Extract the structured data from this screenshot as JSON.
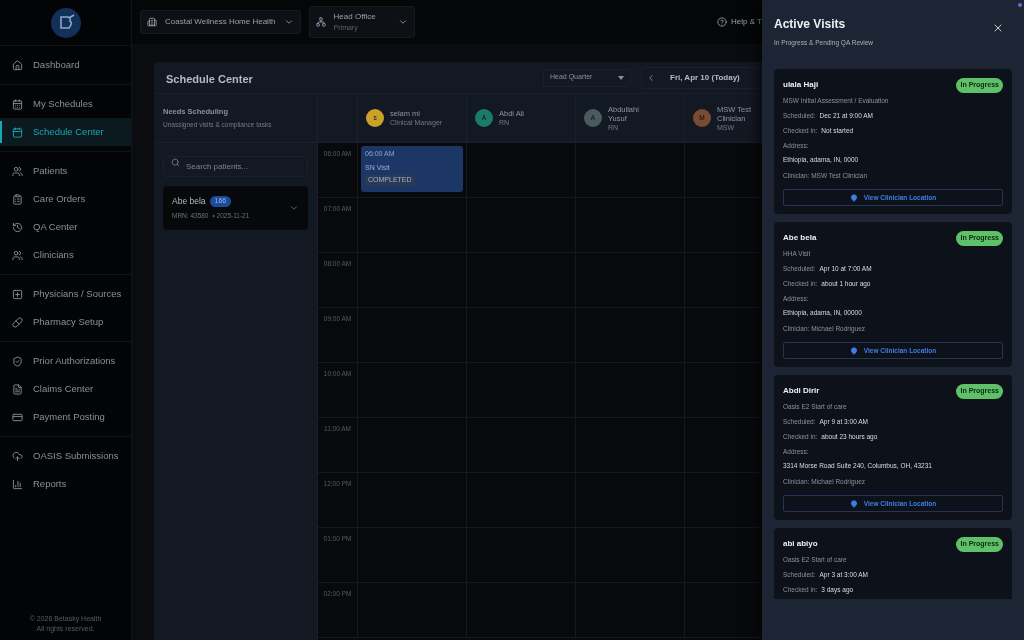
{
  "sidebar": {
    "groups": [
      [
        {
          "label": "Dashboard",
          "selected": false
        }
      ],
      [
        {
          "label": "My Schedules",
          "selected": false
        },
        {
          "label": "Schedule Center",
          "selected": true
        }
      ],
      [
        {
          "label": "Patients",
          "selected": false
        },
        {
          "label": "Care Orders",
          "selected": false
        },
        {
          "label": "QA Center",
          "selected": false
        },
        {
          "label": "Clinicians",
          "selected": false
        }
      ],
      [
        {
          "label": "Physicians / Sources",
          "selected": false
        },
        {
          "label": "Pharmacy Setup",
          "selected": false
        }
      ],
      [
        {
          "label": "Prior Authorizations",
          "selected": false
        },
        {
          "label": "Claims Center",
          "selected": false
        },
        {
          "label": "Payment Posting",
          "selected": false
        }
      ],
      [
        {
          "label": "OASIS Submissions",
          "selected": false
        },
        {
          "label": "Reports",
          "selected": false
        }
      ]
    ],
    "footer": [
      "© 2026 Betasky Health",
      "All rights reserved."
    ]
  },
  "top_bar": {
    "organization": "Coastal Wellness Home Health",
    "office": {
      "name": "Head Office",
      "subtitle": "Primary"
    },
    "help": "Help & T"
  },
  "schedule": {
    "title": "Schedule Center",
    "location_filter": "Head Quarter",
    "date": "Fri, Apr 10 (Today)",
    "needs_scheduling": {
      "title": "Needs Scheduling",
      "subtitle": "Unassigned visits & compliance tasks",
      "search_placeholder": "Search patients...",
      "patients": [
        {
          "name": "Abe bela",
          "count": "166",
          "mrn": "MRN: 43580",
          "date": "• 2025-11-21",
          "expanded": false
        }
      ]
    },
    "clinicians": [
      {
        "initial": "s",
        "name": "selam mi",
        "role": "Clinical Manager",
        "color": "#c9a227",
        "events": [
          {
            "time": "06:00 AM",
            "title": "SN Visit",
            "status": "COMPLETED"
          }
        ]
      },
      {
        "initial": "A",
        "name": "Abdi Ali",
        "role": "RN",
        "color": "#1b7a68"
      },
      {
        "initial": "A",
        "name": "Abdullahi Yusuf",
        "role": "RN",
        "color": "#4a5a5e"
      },
      {
        "initial": "M",
        "name": "MSW Test Clinician",
        "role": "MSW",
        "color": "#7a4a33"
      }
    ],
    "times": [
      "06:00 AM",
      "07:00 AM",
      "08:00 AM",
      "09:00 AM",
      "10:00 AM",
      "11:00 AM",
      "12:00 PM",
      "01:00 PM",
      "02:00 PM"
    ]
  },
  "drawer": {
    "title": "Active Visits",
    "subtitle": "In Progress & Pending QA Review",
    "visits": [
      {
        "name": "ulala Haji",
        "status": "In Progress",
        "type": "MSW Initial Assessment / Evaluation",
        "scheduled_label": "Scheduled:",
        "scheduled": "Dec 21 at 9:00 AM",
        "checked_in_label": "Checked in:",
        "checked_in": "Not started",
        "address_label": "Address:",
        "address": "Ethiopia, adama, IN, 0000",
        "clinician": "Clinician: MSW Test Clinician",
        "action": "View Clinician Location"
      },
      {
        "name": "Abe bela",
        "status": "In Progress",
        "type": "HHA Visit",
        "scheduled_label": "Scheduled:",
        "scheduled": "Apr 10 at 7:00 AM",
        "checked_in_label": "Checked in:",
        "checked_in": "about 1 hour ago",
        "address_label": "Address:",
        "address": "Ethiopia, adama, IN, 00000",
        "clinician": "Clinician: Michael Rodriguez",
        "action": "View Clinician Location"
      },
      {
        "name": "Abdi Dirir",
        "status": "In Progress",
        "type": "Oasis E2 Start of care",
        "scheduled_label": "Scheduled:",
        "scheduled": "Apr 9 at 3:00 AM",
        "checked_in_label": "Checked in:",
        "checked_in": "about 23 hours ago",
        "address_label": "Address:",
        "address": "3314 Morse Road Suite 240, Columbus, OH, 43231",
        "clinician": "Clinician: Michael Rodriguez",
        "action": "View Clinician Location"
      },
      {
        "name": "abi abiyo",
        "status": "In Progress",
        "type": "Oasis E2 Start of care",
        "scheduled_label": "Scheduled:",
        "scheduled": "Apr 3 at 3:00 AM",
        "checked_in_label": "Checked in:",
        "checked_in": "3 days ago"
      }
    ]
  }
}
